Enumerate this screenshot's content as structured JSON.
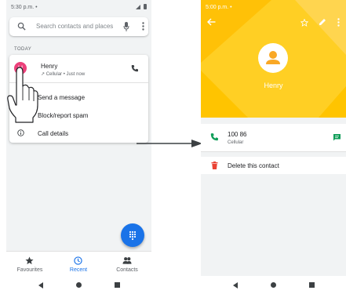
{
  "left_screen": {
    "status_time": "5:30 p.m. •",
    "search_placeholder": "Search contacts and places",
    "section_label": "TODAY",
    "call": {
      "avatar_initial": "H",
      "name": "Henry",
      "detail": "↗ Cellular • Just now"
    },
    "menu": [
      {
        "label": "Send a message"
      },
      {
        "label": "Block/report spam"
      },
      {
        "label": "Call details"
      }
    ],
    "tabs": [
      {
        "label": "Favourites",
        "active": false
      },
      {
        "label": "Recent",
        "active": true
      },
      {
        "label": "Contacts",
        "active": false
      }
    ]
  },
  "right_screen": {
    "status_time": "5:00 p.m. •",
    "contact_name": "Henry",
    "phone": {
      "number": "100 86",
      "type": "Cellular"
    },
    "delete_label": "Delete this contact"
  },
  "colors": {
    "header_yellow": "#ffcf24",
    "accent_blue": "#1a73e8",
    "avatar_pink": "#ec407a",
    "call_green": "#0f9d58",
    "delete_red": "#ea4335"
  }
}
